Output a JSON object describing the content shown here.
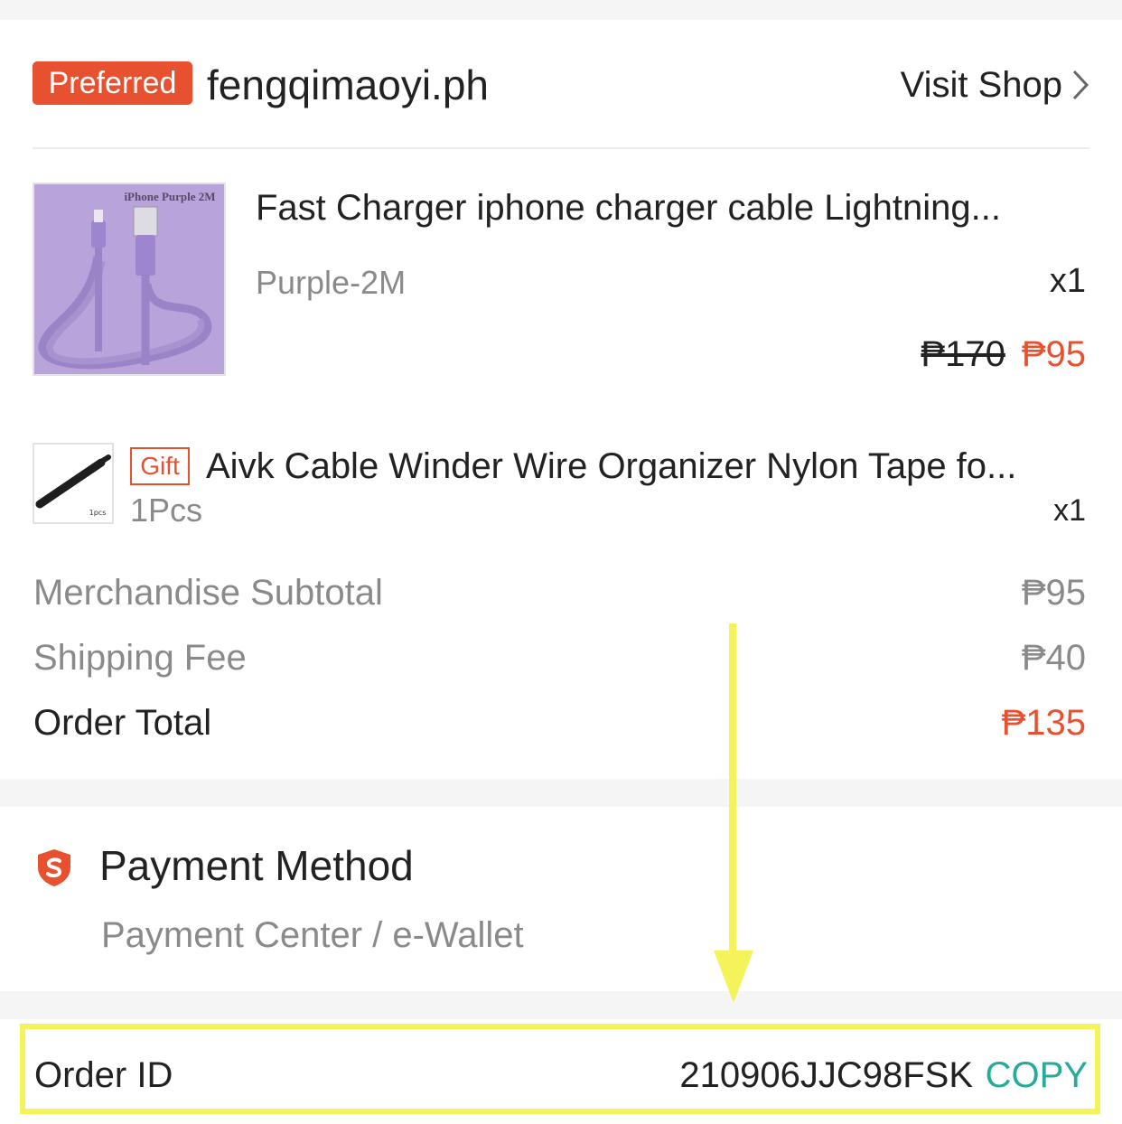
{
  "shop": {
    "badge": "Preferred",
    "name": "fengqimaoyi.ph",
    "visit_label": "Visit Shop"
  },
  "items": [
    {
      "image_caption": "iPhone Purple 2M",
      "title": "Fast Charger iphone charger cable Lightning...",
      "variant": "Purple-2M",
      "quantity": "x1",
      "original_price": "₱170",
      "price": "₱95"
    },
    {
      "tag": "Gift",
      "image_caption": "1pcs",
      "title": "Aivk Cable Winder Wire Organizer Nylon Tape fo...",
      "variant": "1Pcs",
      "quantity": "x1"
    }
  ],
  "summary": {
    "subtotal_label": "Merchandise Subtotal",
    "subtotal_value": "₱95",
    "shipping_label": "Shipping Fee",
    "shipping_value": "₱40",
    "total_label": "Order Total",
    "total_value": "₱135"
  },
  "payment": {
    "icon": "shield-s-icon",
    "title": "Payment Method",
    "method": "Payment Center / e-Wallet"
  },
  "order": {
    "label": "Order ID",
    "id": "210906JJC98FSK",
    "copy_label": "COPY"
  },
  "colors": {
    "accent": "#e8512f",
    "copy": "#26aa99",
    "highlight": "#f4f35a"
  }
}
